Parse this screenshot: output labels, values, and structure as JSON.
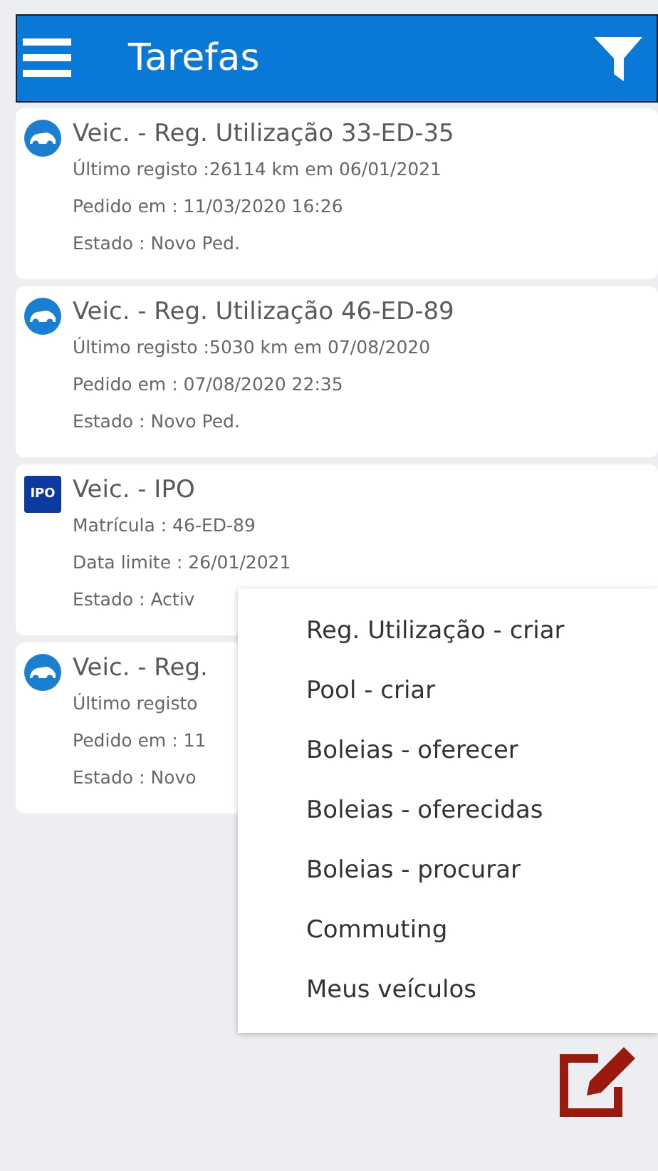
{
  "app_bar": {
    "title": "Tarefas"
  },
  "tasks": [
    {
      "kind": "car",
      "title": "Veic. - Reg. Utilização 33-ED-35",
      "lines": [
        "Último registo :26114 km em 06/01/2021",
        "Pedido em : 11/03/2020 16:26",
        "Estado : Novo Ped."
      ]
    },
    {
      "kind": "car",
      "title": "Veic. - Reg. Utilização 46-ED-89",
      "lines": [
        "Último registo :5030 km em 07/08/2020",
        "Pedido em : 07/08/2020 22:35",
        "Estado : Novo Ped."
      ]
    },
    {
      "kind": "ipo",
      "badge": "IPO",
      "title": "Veic. - IPO",
      "lines": [
        "Matrícula : 46-ED-89",
        "Data limite : 26/01/2021",
        "Estado : Activ"
      ]
    },
    {
      "kind": "car",
      "title": "Veic. - Reg.",
      "lines": [
        "Último registo",
        "Pedido em : 11",
        "Estado : Novo"
      ]
    }
  ],
  "menu": {
    "items": [
      "Reg. Utilização - criar",
      "Pool - criar",
      "Boleias - oferecer",
      "Boleias - oferecidas",
      "Boleias - procurar",
      "Commuting",
      "Meus veículos"
    ]
  }
}
